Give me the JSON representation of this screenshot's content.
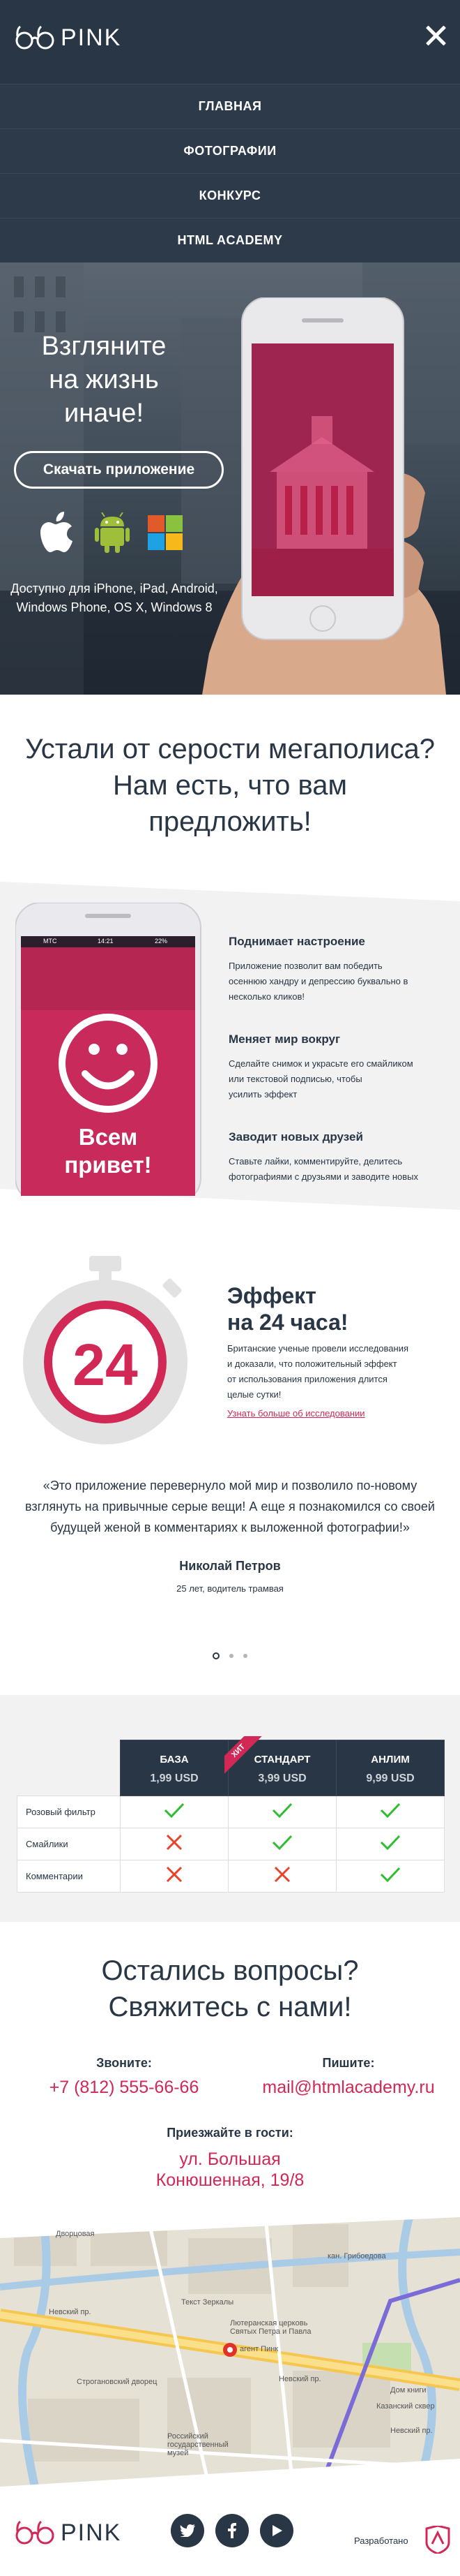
{
  "header": {
    "logo_text": "PINK",
    "menu": [
      {
        "label": "ГЛАВНАЯ"
      },
      {
        "label": "ФОТОГРАФИИ"
      },
      {
        "label": "КОНКУРС"
      },
      {
        "label": "HTML ACADEMY"
      }
    ]
  },
  "hero": {
    "title_line1": "Взгляните",
    "title_line2": "на жизнь",
    "title_line3": "иначе!",
    "button_label": "Скачать приложение",
    "available_line1": "Доступно для iPhone, iPad, Android,",
    "available_line2": "Windows Phone, OS X, Windows 8"
  },
  "tagline": {
    "line1": "Устали от серости мегаполиса?",
    "line2": "Нам есть, что вам",
    "line3": "предложить!"
  },
  "phone_screen": {
    "carrier": "MTC",
    "time": "14:21",
    "battery": "22%",
    "greeting_line1": "Всем",
    "greeting_line2": "привет!"
  },
  "features": [
    {
      "title": "Поднимает настроение",
      "text_line1": "Приложение позволит вам победить",
      "text_line2": "осеннюю хандру и депрессию буквально в",
      "text_line3": "несколько кликов!"
    },
    {
      "title": "Меняет мир вокруг",
      "text_line1": "Сделайте снимок и украсьте его смайликом",
      "text_line2": "или текстовой подписью, чтобы",
      "text_line3": "усилить эффект"
    },
    {
      "title": "Заводит новых друзей",
      "text_line1": "Ставьте лайки, комментируйте, делитесь",
      "text_line2": "фотографиями с друзьями и заводите новых",
      "text_line3": ""
    }
  ],
  "effect": {
    "number": "24",
    "title_line1": "Эффект",
    "title_line2": "на 24 часа!",
    "text_line1": "Британские ученые провели исследования",
    "text_line2": "и доказали, что положительный эффект",
    "text_line3": "от использования приложения длится",
    "text_line4": "целые сутки!",
    "link": "Узнать больше об исследовании"
  },
  "review": {
    "quote_line1": "«Это приложение перевернуло мой мир и позволило по-новому",
    "quote_line2": "взглянуть на привычные серые вещи! А еще я познакомился со своей",
    "quote_line3": "будущей женой в комментариях к выложенной фотографии!»",
    "author": "Николай Петров",
    "author_info": "25 лет, водитель трамвая",
    "active_slide": 1,
    "slides_count": 3
  },
  "prices": {
    "hit_label": "ХИТ",
    "plans": [
      {
        "name": "БАЗА",
        "price": "1,99 USD"
      },
      {
        "name": "СТАНДАРТ",
        "price": "3,99 USD"
      },
      {
        "name": "АНЛИМ",
        "price": "9,99 USD"
      }
    ],
    "rows": [
      {
        "label": "Розовый фильтр",
        "values": [
          true,
          true,
          true
        ]
      },
      {
        "label": "Смайлики",
        "values": [
          false,
          true,
          true
        ]
      },
      {
        "label": "Комментарии",
        "values": [
          false,
          false,
          true
        ]
      }
    ],
    "colors": {
      "yes": "#2ebd2e",
      "no": "#e8432a"
    }
  },
  "contacts": {
    "title_line1": "Остались вопросы?",
    "title_line2": "Свяжитесь с нами!",
    "call_label": "Звоните:",
    "phone": "+7 (812) 555-66-66",
    "write_label": "Пишите:",
    "email": "mail@htmlacademy.ru",
    "visit_label": "Приезжайте в гости:",
    "address_line1": "ул. Большая",
    "address_line2": "Конюшенная, 19/8"
  },
  "map": {
    "labels": {
      "dvortsovaya": "Дворцовая",
      "griboedova": "кан. Грибоедова",
      "nevsky1": "Невский пр.",
      "nevsky2": "Невский пр.",
      "nevsky3": "Невский пр.",
      "stroganov": "Строгановский дворец",
      "lutheran": "Лютеранская церковь Святых Петра и Павла",
      "tipografia": "Текст Зеркалы",
      "kazansky": "Казанский сквер",
      "dom_knigi": "Дом книги",
      "museum": "Российский государственный музей",
      "marker": "агент Пинк"
    }
  },
  "footer": {
    "logo_text": "PINK",
    "developer_label": "Разработано"
  },
  "colors": {
    "dark": "#283645",
    "accent": "#d22856",
    "light_bg": "#f2f2f2"
  }
}
